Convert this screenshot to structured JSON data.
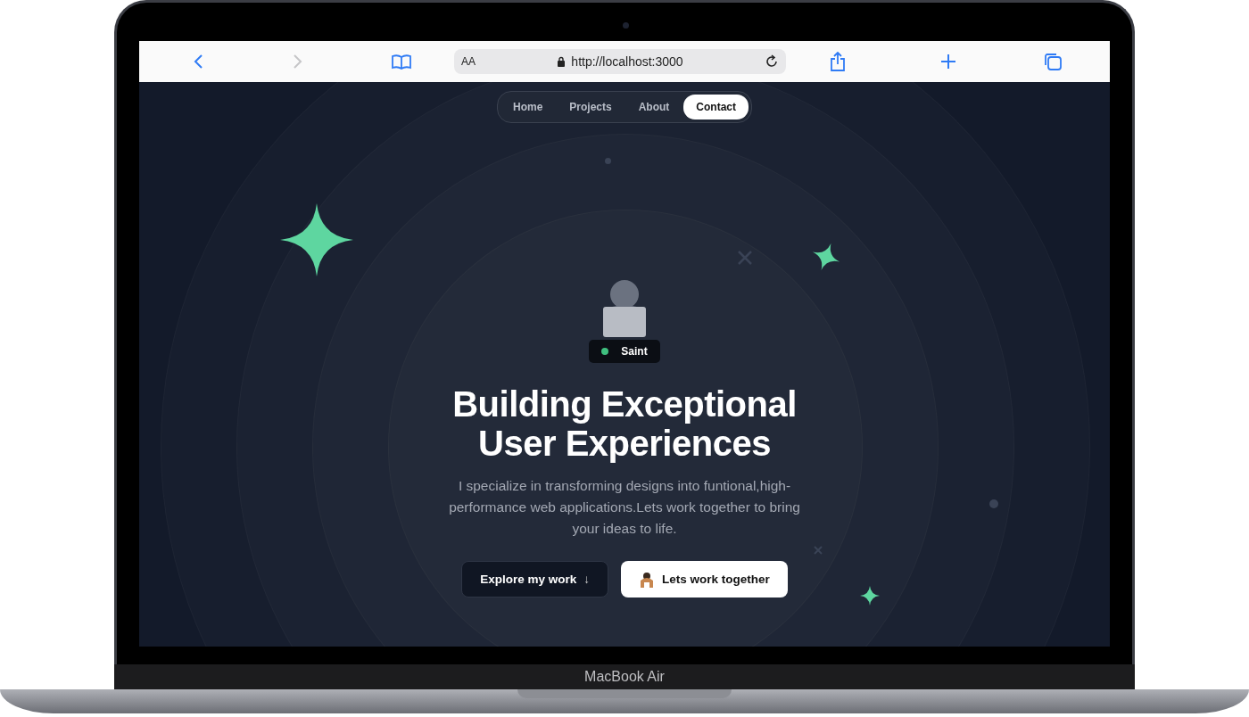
{
  "browser": {
    "text_size_label": "AA",
    "url": "http://localhost:3000"
  },
  "nav": [
    {
      "label": "Home",
      "selected": false
    },
    {
      "label": "Projects",
      "selected": false
    },
    {
      "label": "About",
      "selected": false
    },
    {
      "label": "Contact",
      "selected": true
    }
  ],
  "profile": {
    "name": "Saint",
    "online": true
  },
  "hero": {
    "heading": "Building Exceptional User Experiences",
    "subtitle": "I specialize in transforming designs into funtional,high-performance web applications.Lets work together to bring your ideas to life."
  },
  "buttons": [
    {
      "kind": "outline",
      "label": "Explore my work",
      "icon": "↓"
    },
    {
      "kind": "solid",
      "label": "Lets work together"
    }
  ],
  "device_label": "MacBook Air"
}
